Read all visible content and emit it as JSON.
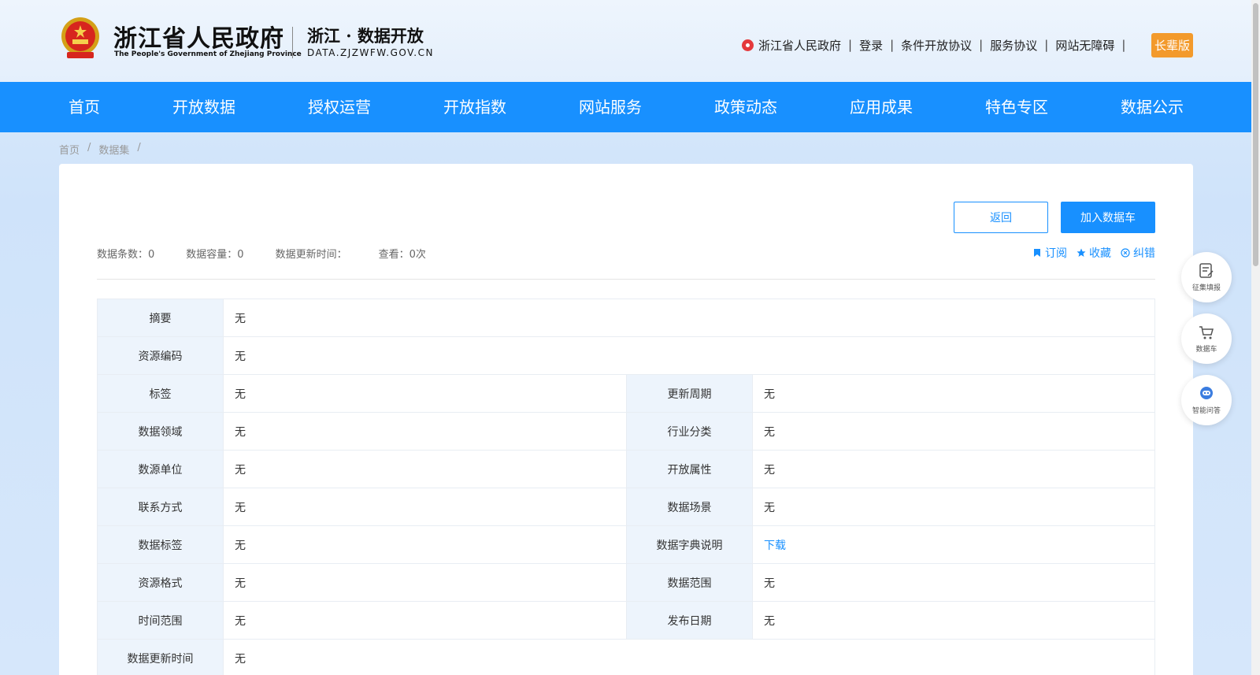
{
  "header": {
    "gov_name_cn": "浙江省人民政府",
    "gov_name_en": "The People's Government of Zhejiang Province",
    "site_name_cn": "浙江 · 数据开放",
    "site_domain": "DATA.ZJZWFW.GOV.CN",
    "top_links": [
      "浙江省人民政府",
      "登录",
      "条件开放协议",
      "服务协议",
      "网站无障碍"
    ],
    "elder_mode": "长辈版"
  },
  "nav": [
    "首页",
    "开放数据",
    "授权运营",
    "开放指数",
    "网站服务",
    "政策动态",
    "应用成果",
    "特色专区",
    "数据公示"
  ],
  "breadcrumb": [
    "首页",
    "/",
    "数据集",
    "/"
  ],
  "buttons": {
    "back": "返回",
    "add_cart": "加入数据车"
  },
  "stats": {
    "count": "数据条数：0",
    "capacity": "数据容量：0",
    "update_time": "数据更新时间：",
    "views": "查看：0次"
  },
  "actions": {
    "subscribe": "订阅",
    "favorite": "收藏",
    "correct": "纠错"
  },
  "table": {
    "summary": {
      "label": "摘要",
      "value": "无"
    },
    "code": {
      "label": "资源编码",
      "value": "无"
    },
    "rows": [
      {
        "l1": "标签",
        "v1": "无",
        "l2": "更新周期",
        "v2": "无"
      },
      {
        "l1": "数据领域",
        "v1": "无",
        "l2": "行业分类",
        "v2": "无"
      },
      {
        "l1": "数源单位",
        "v1": "无",
        "l2": "开放属性",
        "v2": "无"
      },
      {
        "l1": "联系方式",
        "v1": "无",
        "l2": "数据场景",
        "v2": "无"
      },
      {
        "l1": "数据标签",
        "v1": "无",
        "l2": "数据字典说明",
        "v2": "下载"
      },
      {
        "l1": "资源格式",
        "v1": "无",
        "l2": "数据范围",
        "v2": "无"
      },
      {
        "l1": "时间范围",
        "v1": "无",
        "l2": "发布日期",
        "v2": "无"
      }
    ],
    "last": {
      "label": "数据更新时间",
      "value": "无"
    }
  },
  "float": [
    "征集填报",
    "数据车",
    "智能问答"
  ],
  "colors": {
    "primary": "#1890ff",
    "elder": "#f39a2b",
    "label_bg": "#edf4fc"
  }
}
